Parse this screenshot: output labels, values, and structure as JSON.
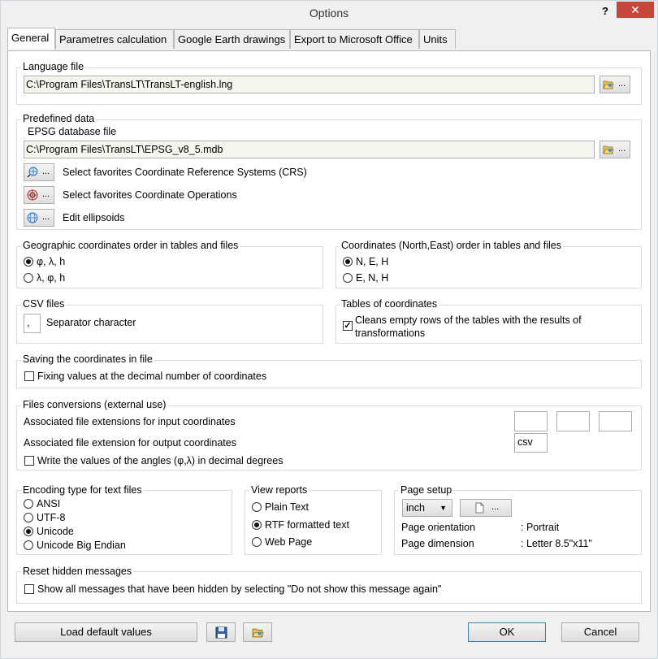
{
  "window": {
    "title": "Options",
    "help": "?",
    "close": "✕"
  },
  "tabs": [
    "General",
    "Parametres calculation",
    "Google Earth drawings",
    "Export to Microsoft Office",
    "Units"
  ],
  "language": {
    "label": "Language file",
    "path": "C:\\Program Files\\TransLT\\TransLT-english.lng",
    "browse": "..."
  },
  "predefined": {
    "label": "Predefined data",
    "epsg_label": "EPSG database file",
    "epsg_path": "C:\\Program Files\\TransLT\\EPSG_v8_5.mdb",
    "browse": "...",
    "crs": "Select favorites Coordinate Reference Systems (CRS)",
    "ops": "Select favorites Coordinate Operations",
    "ellipsoids": "Edit ellipsoids"
  },
  "geo_order": {
    "label": "Geographic coordinates order in tables and files",
    "opt1": "φ, λ, h",
    "opt2": "λ, φ, h"
  },
  "ne_order": {
    "label": "Coordinates (North,East) order in tables and files",
    "opt1": "N, E, H",
    "opt2": "E, N, H"
  },
  "csv": {
    "label": "CSV files",
    "sep_value": ",",
    "sep_label": "Separator character"
  },
  "tables": {
    "label": "Tables of coordinates",
    "clean_line1": "Cleans empty rows of the tables with the results of",
    "clean_line2": "transformations"
  },
  "saving": {
    "label": "Saving the coordinates in file",
    "fixing": "Fixing values at the decimal number of coordinates"
  },
  "conversions": {
    "label": "Files conversions (external use)",
    "input_label": "Associated file extensions for input coordinates",
    "output_label": "Associated file extension for output coordinates",
    "output_value": "csv",
    "angles": "Write the values of the angles (φ,λ) in decimal degrees"
  },
  "encoding": {
    "label": "Encoding type for text files",
    "opts": [
      "ANSI",
      "UTF-8",
      "Unicode",
      "Unicode Big Endian"
    ]
  },
  "reports": {
    "label": "View reports",
    "opts": [
      "Plain Text",
      "RTF formatted text",
      "Web Page"
    ]
  },
  "page": {
    "label": "Page setup",
    "unit": "inch",
    "browse": "...",
    "orientation_label": "Page orientation",
    "orientation_value": ": Portrait",
    "dimension_label": "Page dimension",
    "dimension_value": ": Letter 8.5\"x11\""
  },
  "reset": {
    "label": "Reset hidden messages",
    "show_all": "Show all messages that have been hidden by selecting \"Do not show this message again\""
  },
  "footer": {
    "load_defaults": "Load default values",
    "ok": "OK",
    "cancel": "Cancel"
  }
}
